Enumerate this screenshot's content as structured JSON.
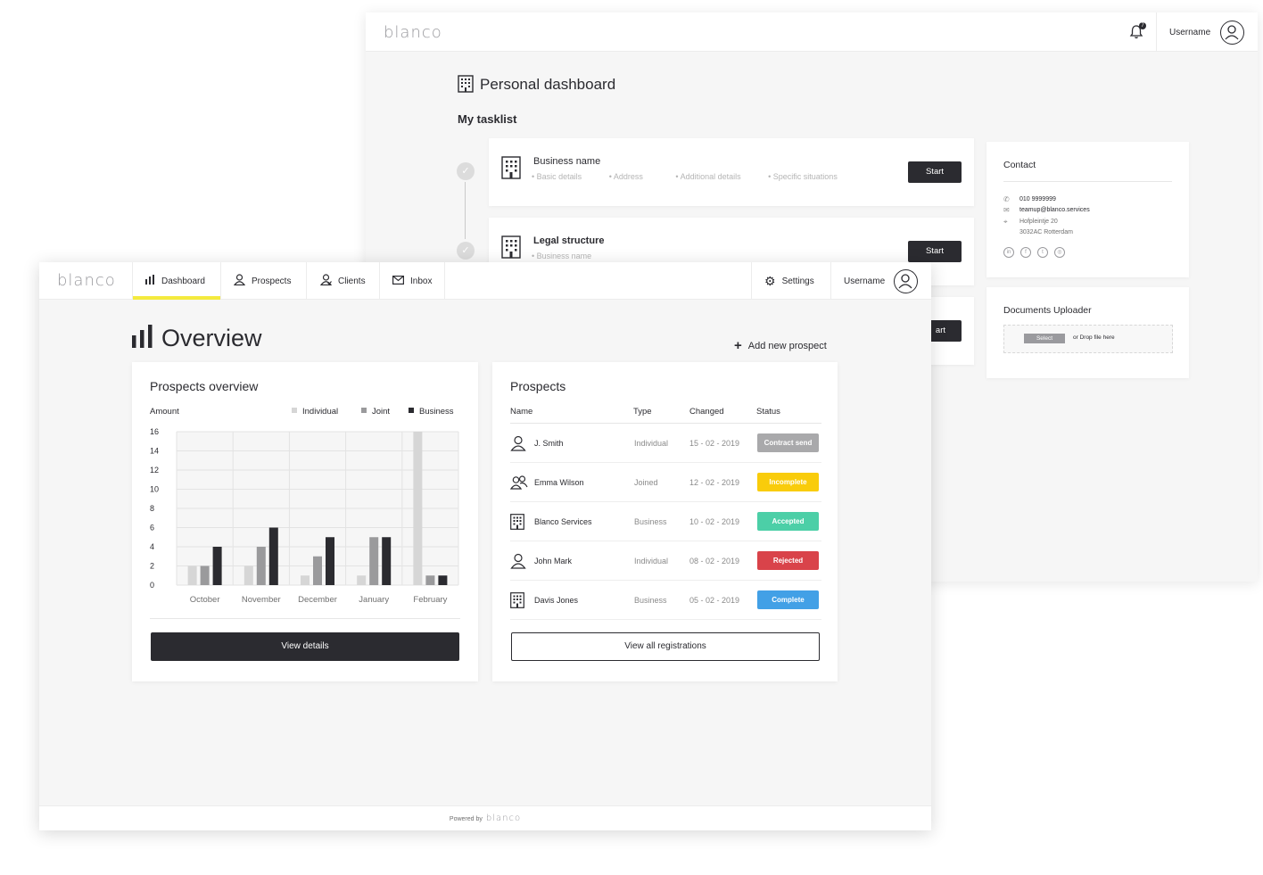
{
  "back": {
    "logo": "blanco",
    "notification_count": "7",
    "username": "Username",
    "title": "Personal dashboard",
    "subtitle": "My tasklist",
    "tasks": [
      {
        "name": "Business name",
        "steps": [
          "Basic details",
          "Address",
          "Additional details",
          "Specific situations"
        ],
        "button": "Start"
      },
      {
        "name": "Legal structure",
        "steps": [
          "Business name"
        ],
        "button": "Start"
      },
      {
        "button_partial": "art"
      }
    ],
    "contact": {
      "title": "Contact",
      "phone": "010 9999999",
      "email": "teamup@blanco.services",
      "address_line1": "Hofpleintje 20",
      "address_line2": "3032AC Rotterdam",
      "socials": [
        "linkedin-icon",
        "facebook-icon",
        "twitter-icon",
        "instagram-icon"
      ]
    },
    "uploader": {
      "title": "Documents Uploader",
      "select": "Select",
      "drop": "or Drop file here"
    }
  },
  "front": {
    "logo": "blanco",
    "nav": {
      "dashboard": "Dashboard",
      "prospects": "Prospects",
      "clients": "Clients",
      "inbox": "Inbox",
      "settings": "Settings",
      "username": "Username"
    },
    "title": "Overview",
    "add_prospect": "Add new prospect",
    "chart_panel": {
      "title": "Prospects overview",
      "button": "View details"
    },
    "prospects_panel": {
      "title": "Prospects",
      "columns": [
        "Name",
        "Type",
        "Changed",
        "Status"
      ],
      "rows": [
        {
          "name": "J. Smith",
          "type": "Individual",
          "changed": "15 - 02 - 2019",
          "status": "Contract send",
          "icon": "person-icon"
        },
        {
          "name": "Emma Wilson",
          "type": "Joined",
          "changed": "12 - 02 - 2019",
          "status": "Incomplete",
          "icon": "people-icon"
        },
        {
          "name": "Blanco Services",
          "type": "Business",
          "changed": "10 - 02 - 2019",
          "status": "Accepted",
          "icon": "building-icon"
        },
        {
          "name": "John Mark",
          "type": "Individual",
          "changed": "08 - 02 - 2019",
          "status": "Rejected",
          "icon": "person-icon"
        },
        {
          "name": "Davis Jones",
          "type": "Business",
          "changed": "05 - 02 - 2019",
          "status": "Complete",
          "icon": "building-icon"
        }
      ],
      "status_colors": {
        "Contract send": "#a9a9ab",
        "Incomplete": "#f9cc0b",
        "Accepted": "#4ccfa7",
        "Rejected": "#d9434a",
        "Complete": "#42a0e6"
      },
      "button": "View all registrations"
    },
    "footer": {
      "powered_by": "Powered by",
      "logo": "blanco"
    }
  },
  "chart_data": {
    "type": "bar",
    "title": "Prospects overview",
    "ylabel": "Amount",
    "xlabel": "",
    "categories": [
      "October",
      "November",
      "December",
      "January",
      "February"
    ],
    "series": [
      {
        "name": "Individual",
        "color": "#d6d6d6",
        "values": [
          2,
          2,
          1,
          1,
          16
        ]
      },
      {
        "name": "Joint",
        "color": "#9a9a9c",
        "values": [
          2,
          4,
          3,
          5,
          1
        ]
      },
      {
        "name": "Business",
        "color": "#2b2b30",
        "values": [
          4,
          6,
          5,
          5,
          1
        ]
      }
    ],
    "yticks": [
      0,
      2,
      4,
      6,
      8,
      10,
      12,
      14,
      16
    ],
    "ylim": [
      0,
      16
    ],
    "grid": true,
    "legend": "top-right"
  }
}
